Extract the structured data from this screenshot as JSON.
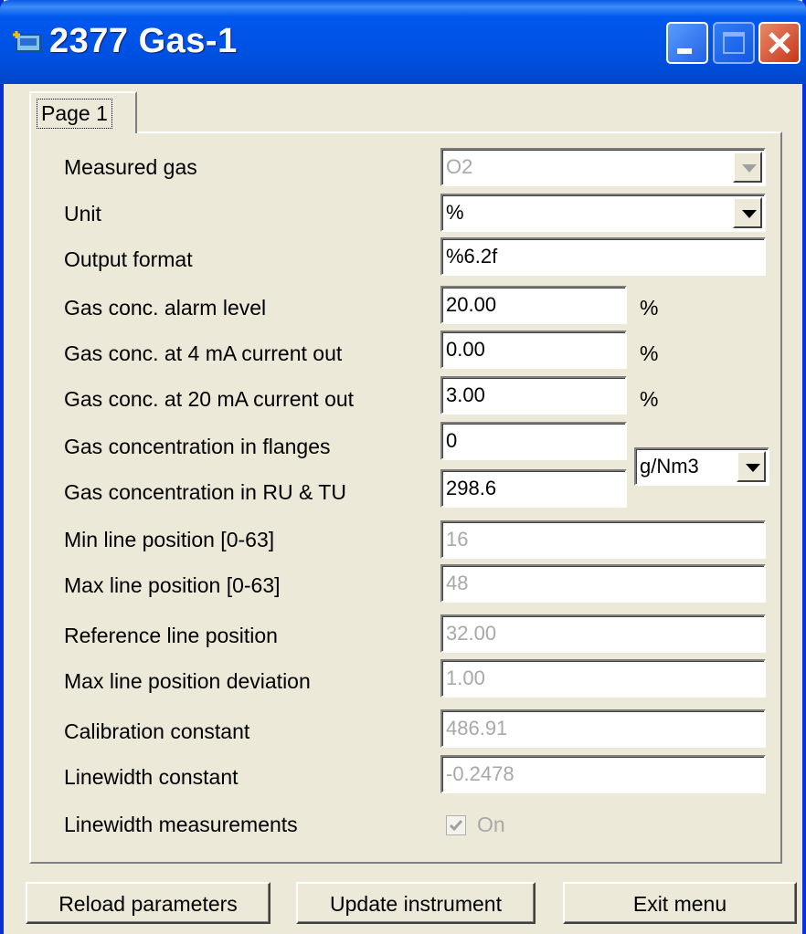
{
  "window": {
    "title": "2377 Gas-1",
    "title_bar_color": "#0054e3",
    "buttons": [
      "minimize-icon",
      "maximize-icon",
      "close-icon"
    ]
  },
  "tabs": [
    {
      "label": "Page 1"
    }
  ],
  "fields": {
    "measured_gas": {
      "label": "Measured gas",
      "value": "O2"
    },
    "unit": {
      "label": "Unit",
      "value": "%"
    },
    "output_format": {
      "label": "Output format",
      "value": "%6.2f"
    },
    "alarm_level": {
      "label": "Gas conc. alarm level",
      "value": "20.00",
      "unit": "%"
    },
    "conc_4ma": {
      "label": "Gas conc. at 4 mA current out",
      "value": "0.00",
      "unit": "%"
    },
    "conc_20ma": {
      "label": "Gas conc. at 20 mA current out",
      "value": "3.00",
      "unit": "%"
    },
    "conc_flanges": {
      "label": "Gas concentration in flanges",
      "value": "0"
    },
    "conc_ru_tu": {
      "label": "Gas concentration in RU & TU",
      "value": "298.6"
    },
    "conc_unit": {
      "value": "g/Nm3"
    },
    "min_line": {
      "label": "Min line position [0-63]",
      "value": "16"
    },
    "max_line": {
      "label": "Max line position [0-63]",
      "value": "48"
    },
    "ref_line": {
      "label": "Reference line position",
      "value": "32.00"
    },
    "max_deviation": {
      "label": "Max line position deviation",
      "value": "1.00"
    },
    "calibration": {
      "label": "Calibration constant",
      "value": "486.91"
    },
    "linewidth_const": {
      "label": "Linewidth constant",
      "value": "-0.2478"
    },
    "linewidth_meas": {
      "label": "Linewidth measurements",
      "checkbox_label": "On",
      "checked": true
    }
  },
  "buttons": {
    "reload": "Reload parameters",
    "update": "Update instrument",
    "exit": "Exit menu"
  }
}
